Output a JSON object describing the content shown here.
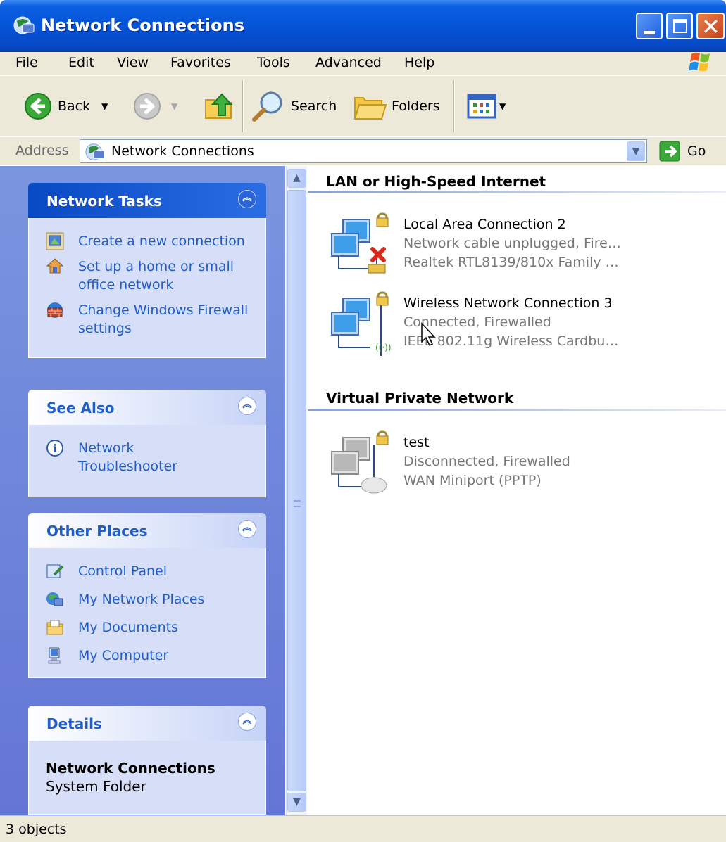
{
  "window": {
    "title": "Network Connections"
  },
  "menu": [
    "File",
    "Edit",
    "View",
    "Favorites",
    "Tools",
    "Advanced",
    "Help"
  ],
  "toolbar": {
    "back_label": "Back",
    "search_label": "Search",
    "folders_label": "Folders"
  },
  "address": {
    "label": "Address",
    "value": "Network Connections",
    "go_label": "Go"
  },
  "taskpane": {
    "network_tasks": {
      "title": "Network Tasks",
      "items": [
        "Create a new connection",
        "Set up a home or small office network",
        "Change Windows Firewall settings"
      ]
    },
    "see_also": {
      "title": "See Also",
      "items": [
        "Network Troubleshooter"
      ]
    },
    "other_places": {
      "title": "Other Places",
      "items": [
        "Control Panel",
        "My Network Places",
        "My Documents",
        "My Computer"
      ]
    },
    "details": {
      "title": "Details",
      "name": "Network Connections",
      "type": "System Folder"
    }
  },
  "groups": [
    {
      "title": "LAN or High-Speed Internet",
      "connections": [
        {
          "name": "Local Area Connection 2",
          "status": "Network cable unplugged, Fire…",
          "device": "Realtek RTL8139/810x Family …"
        },
        {
          "name": "Wireless Network Connection 3",
          "status": "Connected, Firewalled",
          "device": "IEEE 802.11g Wireless Cardbu…"
        }
      ]
    },
    {
      "title": "Virtual Private Network",
      "connections": [
        {
          "name": "test",
          "status": "Disconnected, Firewalled",
          "device": "WAN Miniport (PPTP)"
        }
      ]
    }
  ],
  "status": {
    "text": "3 objects"
  }
}
